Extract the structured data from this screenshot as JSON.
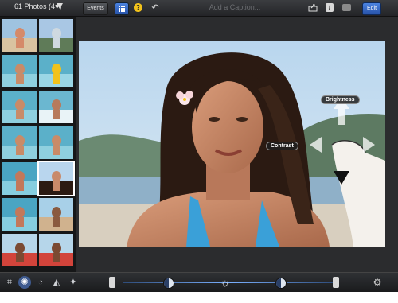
{
  "topbar": {
    "album_title": "61 Photos (4♥)",
    "events_label": "Events",
    "help_label": "?",
    "caption_placeholder": "Add a Caption...",
    "info_label": "i",
    "edit_label": "Edit"
  },
  "photo": {
    "brightness_label": "Brightness",
    "contrast_label": "Contrast"
  },
  "colors": {
    "accent": "#2f63c2",
    "help": "#f2c21b"
  },
  "sidebar": {
    "thumbs": [
      {
        "row": 0,
        "col": 0,
        "scene": "beach-jump",
        "selected": false
      },
      {
        "row": 0,
        "col": 1,
        "scene": "coast",
        "selected": false
      },
      {
        "row": 1,
        "col": 0,
        "scene": "water",
        "selected": false
      },
      {
        "row": 1,
        "col": 1,
        "scene": "water-ball",
        "selected": false
      },
      {
        "row": 2,
        "col": 0,
        "scene": "water",
        "selected": false
      },
      {
        "row": 2,
        "col": 1,
        "scene": "splash",
        "selected": false
      },
      {
        "row": 3,
        "col": 0,
        "scene": "water",
        "selected": false
      },
      {
        "row": 3,
        "col": 1,
        "scene": "water",
        "selected": false
      },
      {
        "row": 4,
        "col": 0,
        "scene": "surf",
        "selected": false
      },
      {
        "row": 4,
        "col": 1,
        "scene": "woman",
        "selected": true
      },
      {
        "row": 5,
        "col": 0,
        "scene": "surf",
        "selected": false
      },
      {
        "row": 5,
        "col": 1,
        "scene": "man",
        "selected": false
      },
      {
        "row": 6,
        "col": 0,
        "scene": "people",
        "selected": false
      },
      {
        "row": 6,
        "col": 1,
        "scene": "people",
        "selected": false
      }
    ]
  },
  "toolbar": {
    "tools": [
      "crop-icon",
      "adjust-icon",
      "color-icon",
      "effects-icon",
      "brush-icon"
    ],
    "slider": {
      "exposure_level": 0.5
    }
  }
}
